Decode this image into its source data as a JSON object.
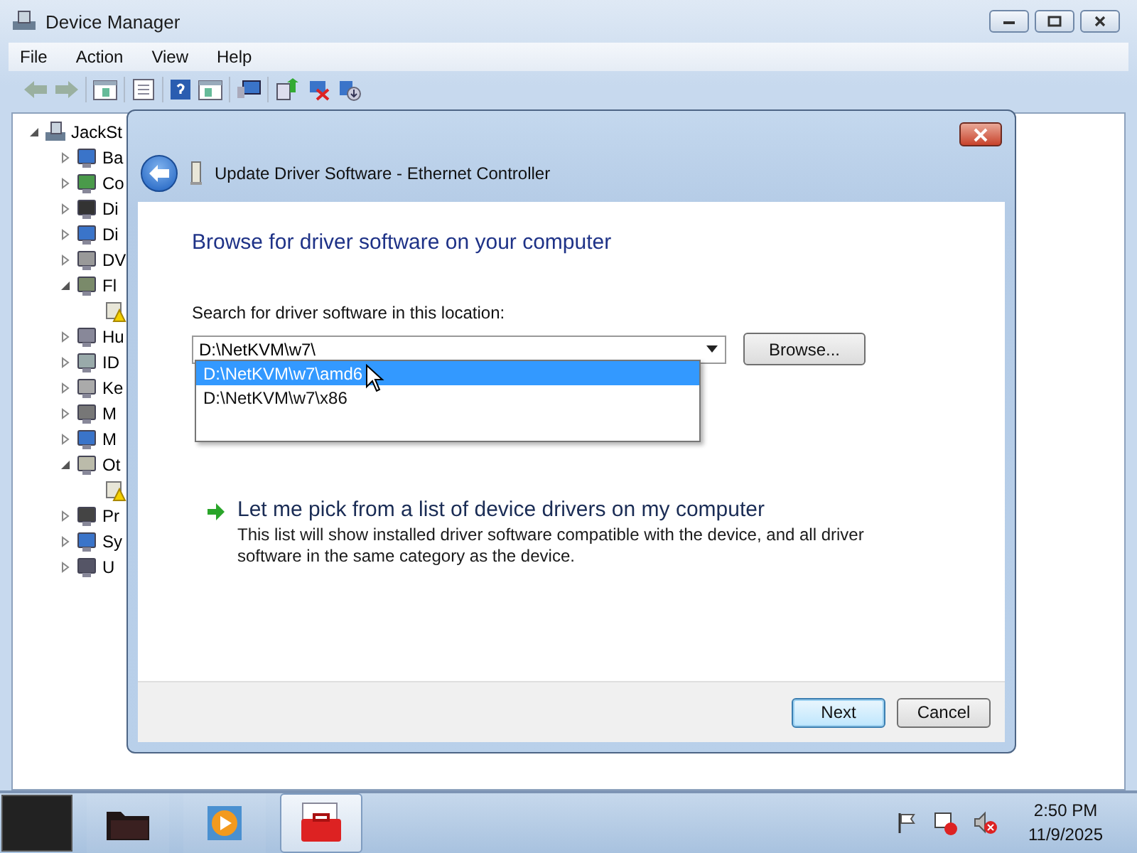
{
  "window": {
    "title": "Device Manager"
  },
  "menu": [
    "File",
    "Action",
    "View",
    "Help"
  ],
  "tree": {
    "label": "JackSt",
    "expanded": true,
    "children": [
      {
        "label": "Ba",
        "expanded": false
      },
      {
        "label": "Co",
        "expanded": false
      },
      {
        "label": "Di",
        "expanded": false
      },
      {
        "label": "Di",
        "expanded": false
      },
      {
        "label": "DV",
        "expanded": false
      },
      {
        "label": "Fl",
        "expanded": true,
        "children": [
          {
            "kind": "warning"
          }
        ]
      },
      {
        "label": "Hu",
        "expanded": false
      },
      {
        "label": "ID",
        "expanded": false
      },
      {
        "label": "Ke",
        "expanded": false
      },
      {
        "label": "M",
        "expanded": false
      },
      {
        "label": "M",
        "expanded": false
      },
      {
        "label": "Ot",
        "expanded": true,
        "children": [
          {
            "kind": "warning"
          }
        ]
      },
      {
        "label": "Pr",
        "expanded": false
      },
      {
        "label": "Sy",
        "expanded": false
      },
      {
        "label": "U",
        "expanded": false
      }
    ]
  },
  "dialog": {
    "title": "Update Driver Software - Ethernet Controller",
    "heading": "Browse for driver software on your computer",
    "location_label": "Search for driver software in this location:",
    "location": {
      "value": "D:\\NetKVM\\w7\\",
      "options": [
        {
          "label": "D:\\NetKVM\\w7\\amd6",
          "selected": true
        },
        {
          "label": "D:\\NetKVM\\w7\\x86",
          "selected": false
        }
      ]
    },
    "browse_button": "Browse...",
    "pick_link": "Let me pick from a list of device drivers on my computer",
    "pick_description": "This list will show installed driver software compatible with the device, and all driver software in the same category as the device.",
    "buttons": [
      {
        "label": "Next",
        "default": true
      },
      {
        "label": "Cancel",
        "default": false
      }
    ]
  },
  "clock": {
    "time": "2:50 PM",
    "date": "11/9/2025"
  }
}
